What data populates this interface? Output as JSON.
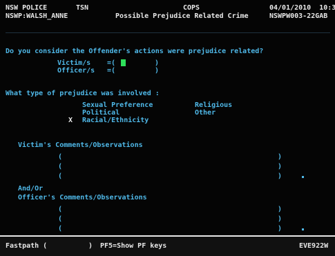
{
  "header": {
    "org": "NSW POLICE",
    "tsn": "TSN",
    "system": "COPS",
    "date_time": "04/01/2010  10:3",
    "user": "NSWP:WALSH_ANNE",
    "screen_title": "Possible Prejudice Related Crime",
    "screen_id": "NSWPW003-22GAB"
  },
  "question": {
    "text": "Do you consider the Offender's actions were prejudice related?",
    "victim_label": "Victim/s",
    "victim_open": "=(",
    "victim_value": "",
    "victim_close": ")",
    "officer_label": "Officer/s",
    "officer_open": "=(",
    "officer_value": "",
    "officer_close": ")"
  },
  "prejudice": {
    "heading": "What type of prejudice was involved :",
    "options": [
      {
        "mark": "",
        "label": "Sexual Preference"
      },
      {
        "mark": "",
        "label": "Religious"
      },
      {
        "mark": "",
        "label": "Political"
      },
      {
        "mark": "",
        "label": "Other"
      },
      {
        "mark": "X",
        "label": "Racial/Ethnicity"
      }
    ]
  },
  "victim_comments": {
    "heading": "Victim's Comments/Observations",
    "lines": [
      "",
      "",
      ""
    ]
  },
  "connector": "And/Or",
  "officer_comments": {
    "heading": "Officer's Comments/Observations",
    "lines": [
      "",
      "",
      ""
    ]
  },
  "footer": {
    "fastpath_label": "Fastpath (",
    "fastpath_close": ")",
    "help_text": "PF5=Show PF keys",
    "screen_code": "EVE922W"
  },
  "colors": {
    "text": "#e8e8e8",
    "prompt": "#4fb8e8",
    "input": "#5fd070",
    "cursor": "#2ee05a"
  }
}
